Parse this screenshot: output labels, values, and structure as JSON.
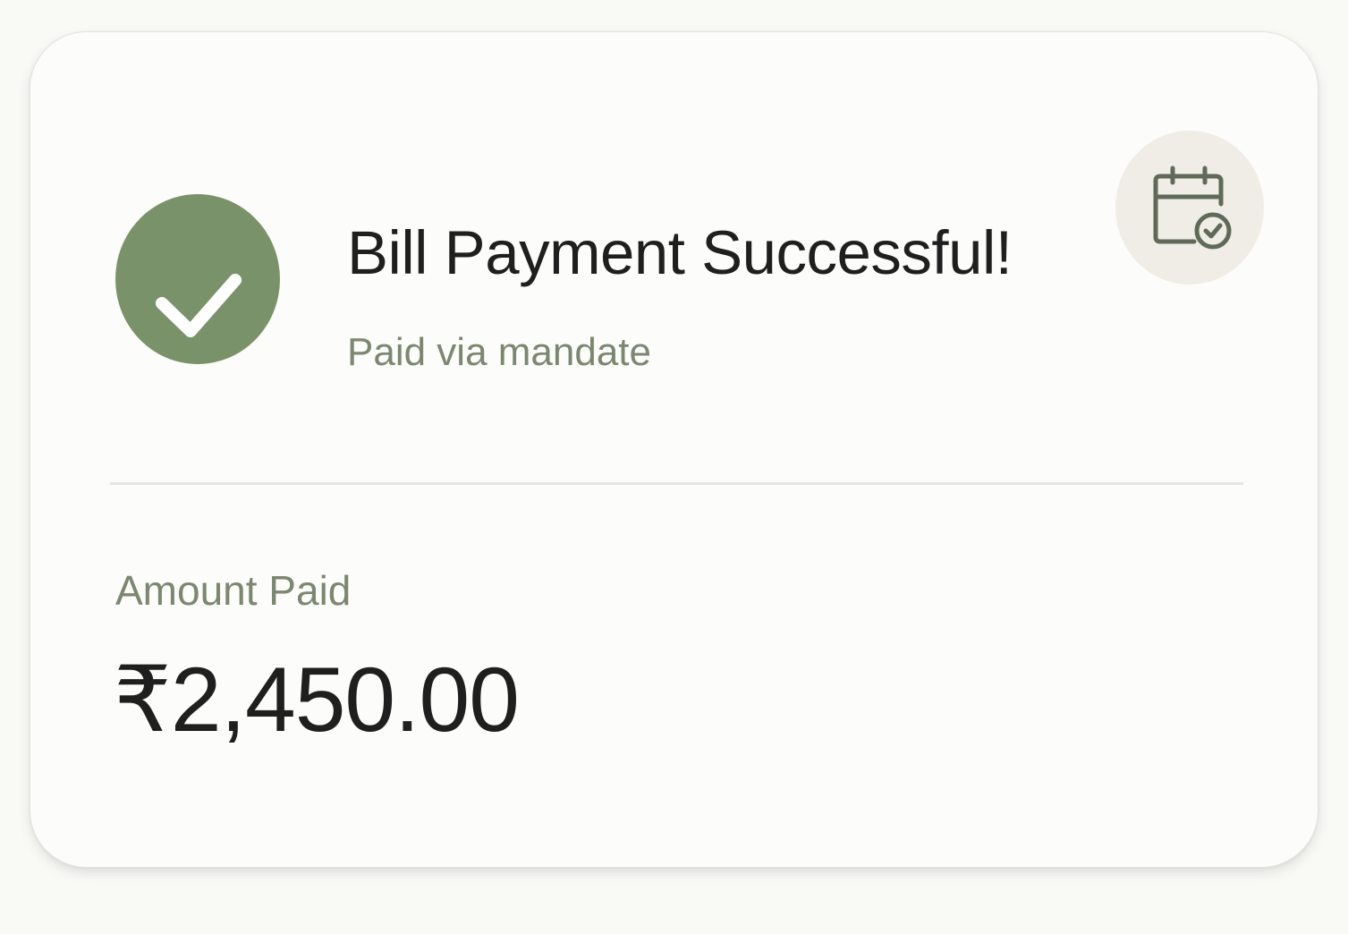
{
  "colors": {
    "success": "#7a926a",
    "subtle_text": "#7c8770",
    "primary_text": "#1f1f1f",
    "icon_bg": "#efede6",
    "icon_stroke": "#5f6b58"
  },
  "icons": {
    "status": "checkmark-icon",
    "action": "calendar-check-icon"
  },
  "header": {
    "title": "Bill Payment Successful!",
    "subtitle": "Paid via mandate"
  },
  "amount": {
    "label": "Amount Paid",
    "value": "₹2,450.00"
  }
}
